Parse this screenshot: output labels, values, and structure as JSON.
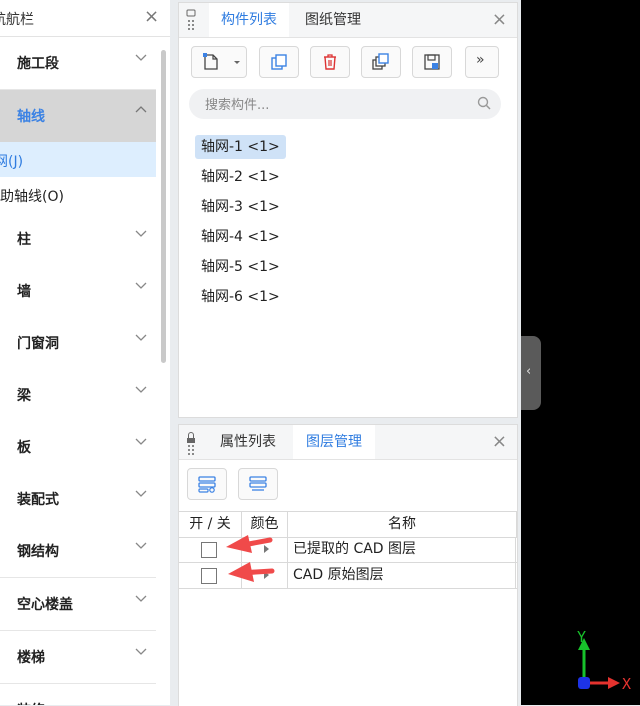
{
  "nav": {
    "title": "航航栏",
    "close": "×",
    "items": [
      {
        "label": "施工段"
      },
      {
        "label": "轴线"
      },
      {
        "label": "柱"
      },
      {
        "label": "墙"
      },
      {
        "label": "门窗洞"
      },
      {
        "label": "梁"
      },
      {
        "label": "板"
      },
      {
        "label": "装配式"
      },
      {
        "label": "钢结构"
      },
      {
        "label": "空心楼盖"
      },
      {
        "label": "楼梯"
      },
      {
        "label": "装修"
      }
    ],
    "sub_items": [
      {
        "label": "轴网(J)"
      },
      {
        "label": "辅助轴线(O)"
      }
    ]
  },
  "top_panel": {
    "tabs": [
      "构件列表",
      "图纸管理"
    ],
    "close": "×",
    "search_placeholder": "搜索构件...",
    "more": "»",
    "components": [
      {
        "label": "轴网-1 <1>"
      },
      {
        "label": "轴网-2 <1>"
      },
      {
        "label": "轴网-3 <1>"
      },
      {
        "label": "轴网-4 <1>"
      },
      {
        "label": "轴网-5 <1>"
      },
      {
        "label": "轴网-6 <1>"
      }
    ]
  },
  "bottom_panel": {
    "tabs": [
      "属性列表",
      "图层管理"
    ],
    "close": "×",
    "table_headers": [
      "开 / 关",
      "颜色",
      "名称"
    ],
    "rows": [
      {
        "name": "已提取的 CAD 图层"
      },
      {
        "name": "CAD 原始图层"
      }
    ]
  },
  "viewport": {
    "collapse": "‹",
    "axis_y": "Y",
    "axis_x": "X"
  },
  "colors": {
    "accent": "#2f7ce0",
    "arrow": "#f04a4a",
    "axis_y": "#17c22b",
    "axis_x": "#e4322e",
    "axis_origin": "#1d33e6"
  }
}
